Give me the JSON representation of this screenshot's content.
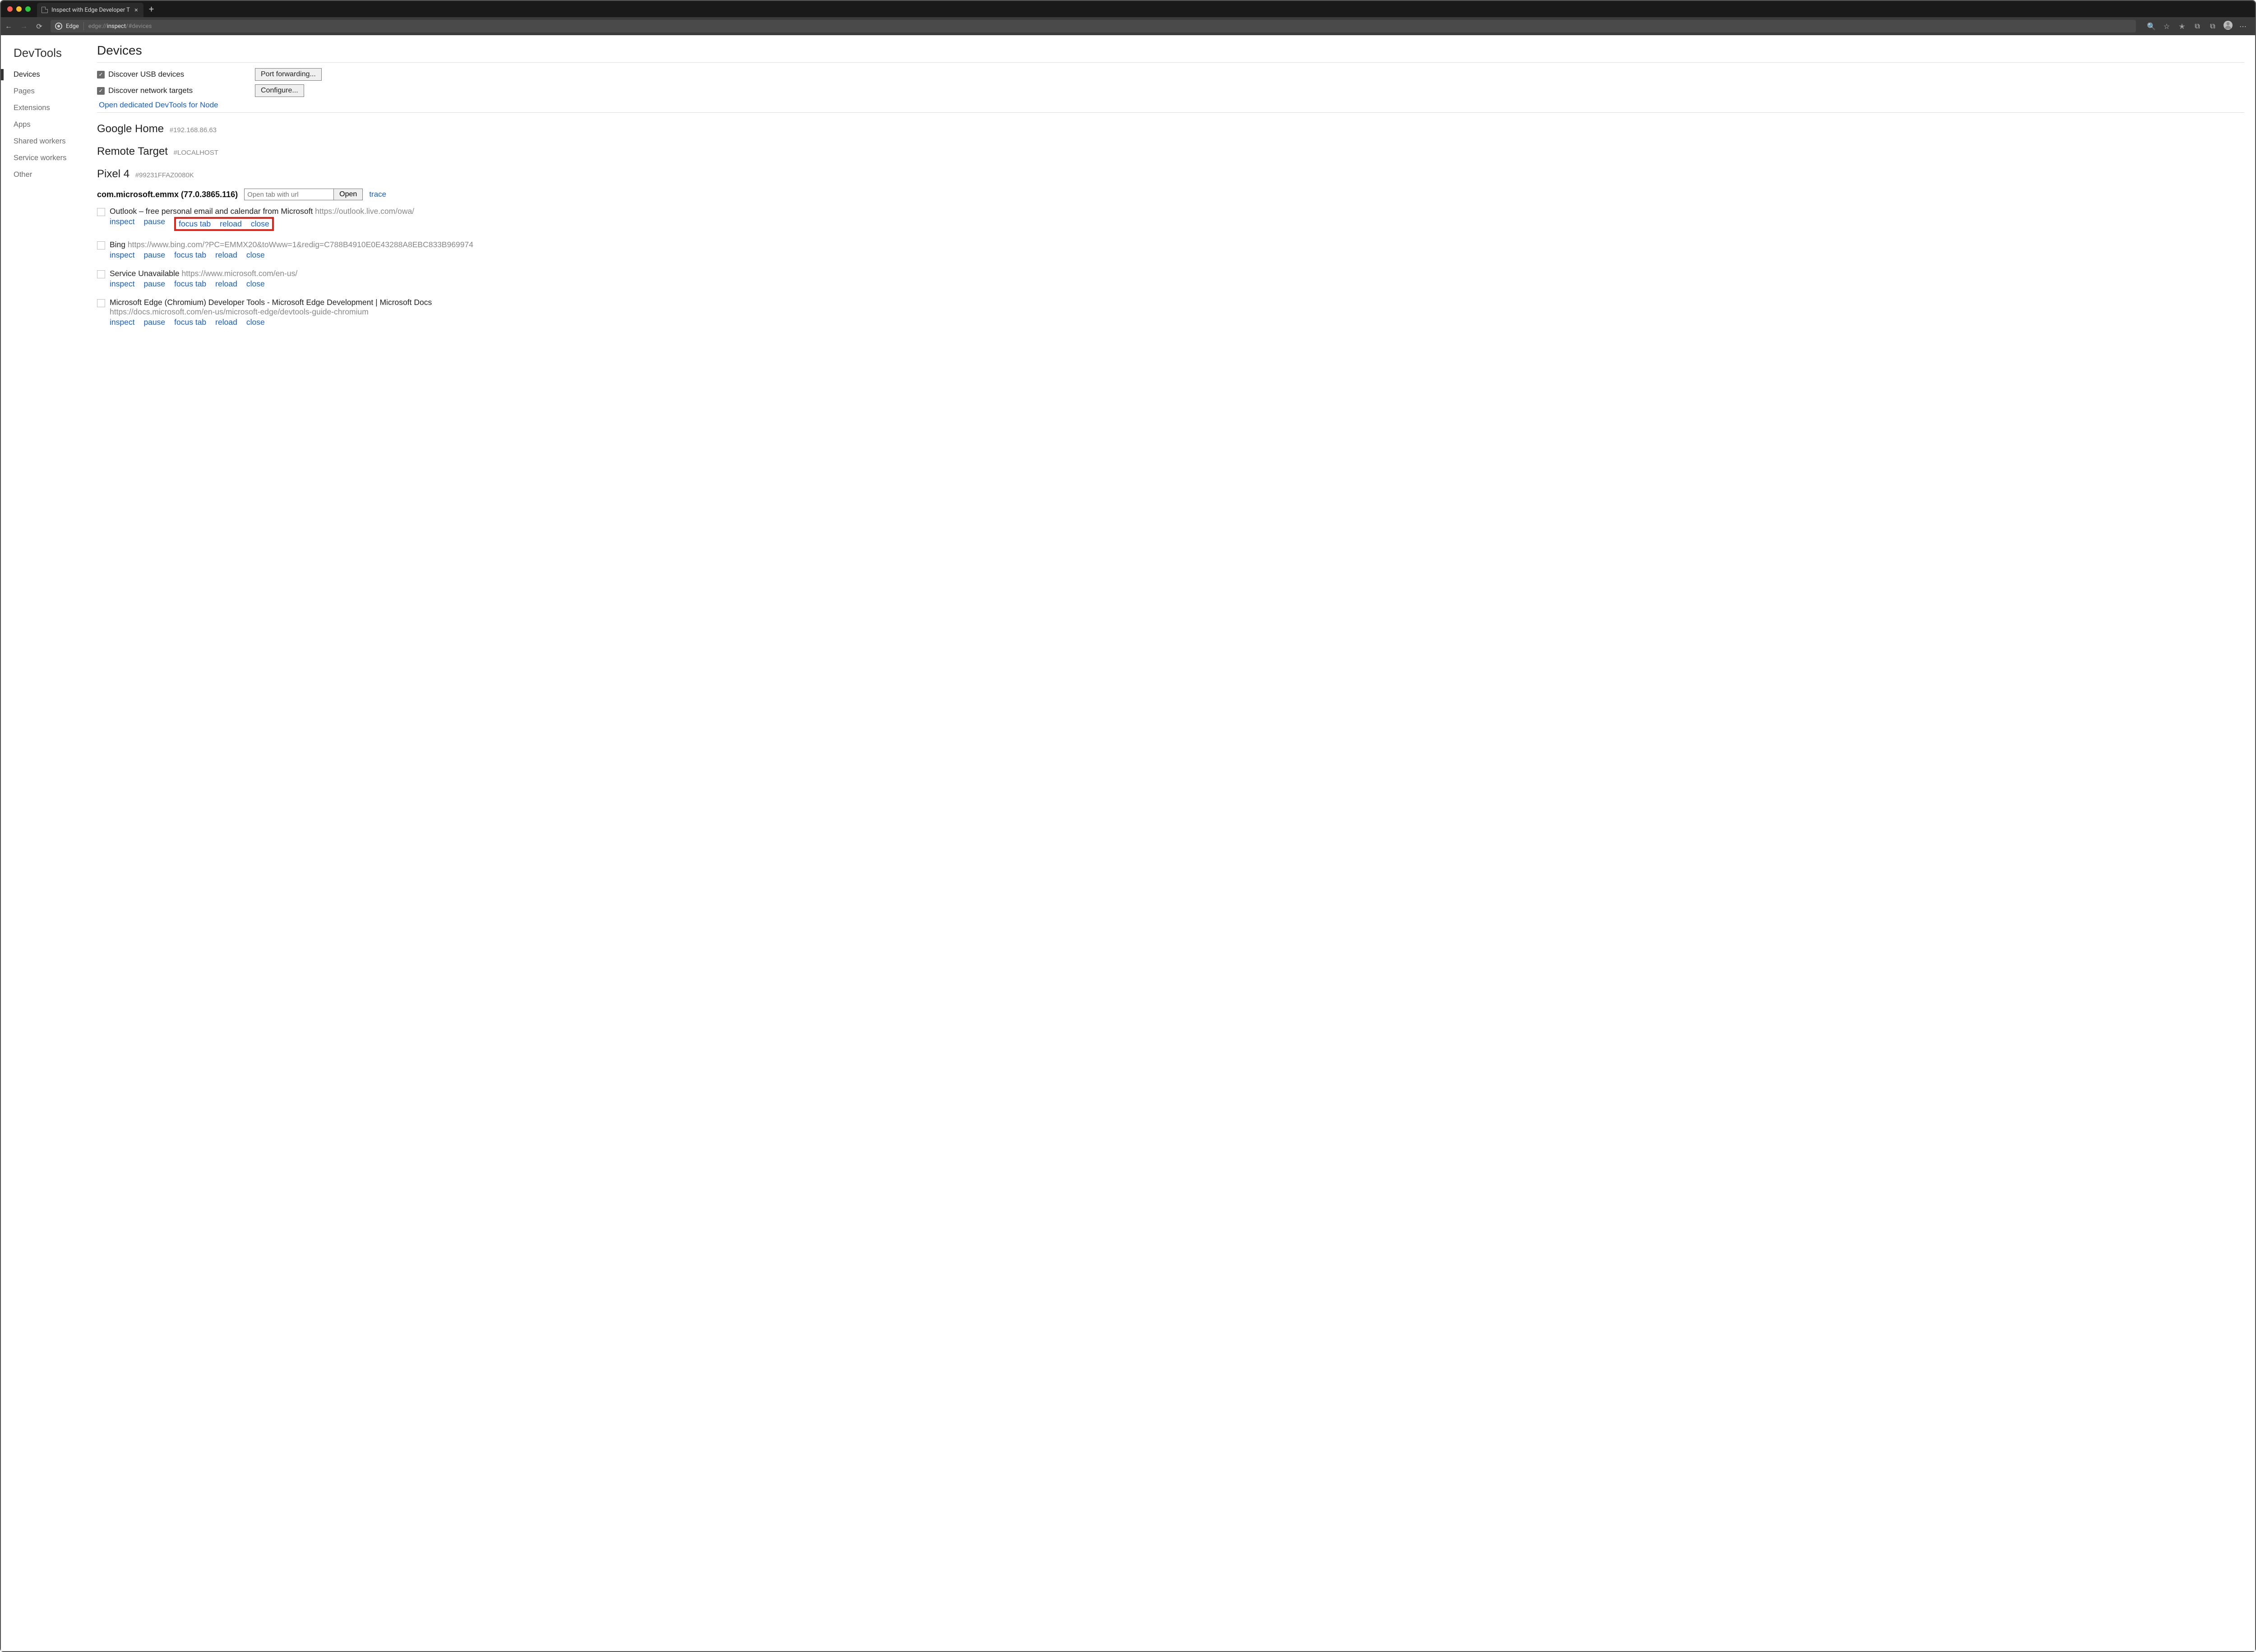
{
  "window": {
    "tab_title": "Inspect with Edge Developer T",
    "close_glyph": "×",
    "new_tab_glyph": "+"
  },
  "toolbar": {
    "brand": "Edge",
    "url_prefix": "edge://",
    "url_strong": "inspect",
    "url_suffix": "/#devices"
  },
  "sidebar": {
    "title": "DevTools",
    "items": [
      {
        "label": "Devices",
        "active": true
      },
      {
        "label": "Pages"
      },
      {
        "label": "Extensions"
      },
      {
        "label": "Apps"
      },
      {
        "label": "Shared workers"
      },
      {
        "label": "Service workers"
      },
      {
        "label": "Other"
      }
    ]
  },
  "main": {
    "title": "Devices",
    "usb_label": "Discover USB devices",
    "net_label": "Discover network targets",
    "port_btn": "Port forwarding...",
    "conf_btn": "Configure...",
    "node_link": "Open dedicated DevTools for Node",
    "targets": [
      {
        "name": "Google Home",
        "hash": "#192.168.86.63"
      },
      {
        "name": "Remote Target",
        "hash": "#LOCALHOST"
      },
      {
        "name": "Pixel 4",
        "hash": "#99231FFAZ0080K"
      }
    ],
    "package": "com.microsoft.emmx (77.0.3865.116)",
    "open_placeholder": "Open tab with url",
    "open_btn": "Open",
    "trace": "trace",
    "actions": {
      "inspect": "inspect",
      "pause": "pause",
      "focus": "focus tab",
      "reload": "reload",
      "close": "close"
    },
    "entries": [
      {
        "title": "Outlook – free personal email and calendar from Microsoft",
        "url": "https://outlook.live.com/owa/",
        "highlight": true,
        "url_inline": true
      },
      {
        "title": "Bing",
        "url": "https://www.bing.com/?PC=EMMX20&toWww=1&redig=C788B4910E0E43288A8EBC833B969974",
        "url_inline": true
      },
      {
        "title": "Service Unavailable",
        "url": "https://www.microsoft.com/en-us/",
        "url_inline": true
      },
      {
        "title": "Microsoft Edge (Chromium) Developer Tools - Microsoft Edge Development | Microsoft Docs",
        "url": "https://docs.microsoft.com/en-us/microsoft-edge/devtools-guide-chromium",
        "url_inline": false
      }
    ]
  }
}
